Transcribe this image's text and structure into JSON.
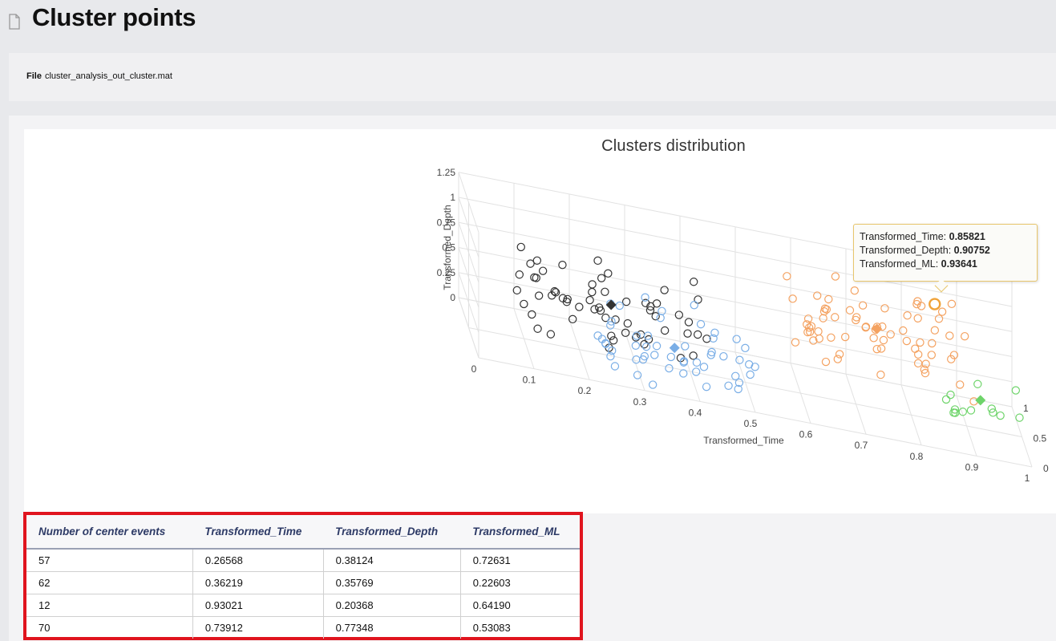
{
  "page": {
    "title": "Cluster points",
    "file_label": "File",
    "file_name": "cluster_analysis_out_cluster.mat"
  },
  "icons": {
    "title_icon": "document-icon"
  },
  "colors": {
    "cluster_blue": "#7aaee6",
    "cluster_dark": "#333333",
    "cluster_orange": "#f4a261",
    "cluster_green": "#6ed46a",
    "highlight_border": "#e0141e"
  },
  "tooltip": {
    "line1_label": "Transformed_Time:",
    "line1_value": "0.85821",
    "line2_label": "Transformed_Depth:",
    "line2_value": "0.90752",
    "line3_label": "Transformed_ML:",
    "line3_value": "0.93641"
  },
  "chart_data": {
    "type": "scatter",
    "title": "Clusters distribution",
    "xlabel": "Transformed_Time",
    "ylabel": "Transformed_Depth",
    "xticks": [
      "0",
      "0.1",
      "0.2",
      "0.3",
      "0.4",
      "0.5",
      "0.6",
      "0.7",
      "0.8",
      "0.9",
      "1"
    ],
    "yticks": [
      "0",
      "0.25",
      "0.5",
      "0.75",
      "1",
      "1.25"
    ],
    "zticks": [
      "0",
      "0.5",
      "1"
    ],
    "xlim": [
      0,
      1
    ],
    "ylim": [
      0,
      1.25
    ],
    "zlim": [
      0,
      1
    ],
    "centers": [
      {
        "cluster": "dark",
        "time": 0.26568,
        "depth": 0.38124,
        "ml": 0.72631
      },
      {
        "cluster": "blue",
        "time": 0.36219,
        "depth": 0.35769,
        "ml": 0.22603
      },
      {
        "cluster": "green",
        "time": 0.93021,
        "depth": 0.20368,
        "ml": 0.6419
      },
      {
        "cluster": "orange",
        "time": 0.73912,
        "depth": 0.77348,
        "ml": 0.53083
      }
    ],
    "highlighted_point": {
      "time": 0.85821,
      "depth": 0.90752,
      "ml": 0.93641
    }
  },
  "table": {
    "headers": [
      "Number of center events",
      "Transformed_Time",
      "Transformed_Depth",
      "Transformed_ML"
    ],
    "rows": [
      [
        "57",
        "0.26568",
        "0.38124",
        "0.72631"
      ],
      [
        "62",
        "0.36219",
        "0.35769",
        "0.22603"
      ],
      [
        "12",
        "0.93021",
        "0.20368",
        "0.64190"
      ],
      [
        "70",
        "0.73912",
        "0.77348",
        "0.53083"
      ]
    ]
  }
}
